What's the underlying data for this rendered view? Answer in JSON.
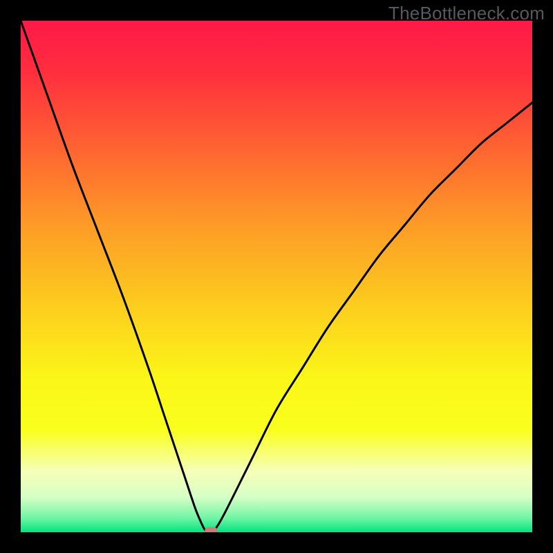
{
  "watermark": "TheBottleneck.com",
  "chart_data": {
    "type": "line",
    "title": "",
    "xlabel": "",
    "ylabel": "",
    "xlim": [
      0,
      100
    ],
    "ylim": [
      0,
      100
    ],
    "grid": false,
    "legend": false,
    "series": [
      {
        "name": "curve",
        "x": [
          0,
          5,
          10,
          15,
          20,
          25,
          28,
          30,
          32,
          34,
          35,
          36,
          37,
          38,
          40,
          45,
          50,
          55,
          60,
          65,
          70,
          75,
          80,
          85,
          90,
          95,
          100
        ],
        "y": [
          100,
          86,
          72,
          59,
          46,
          32,
          23,
          17,
          11,
          5,
          2.5,
          0.5,
          0,
          0.6,
          4,
          14,
          24,
          32,
          40,
          47,
          54,
          60,
          66,
          71,
          76,
          80,
          84
        ]
      }
    ],
    "marker": {
      "x": 37.2,
      "y": 0.3,
      "color": "#cf7a74"
    },
    "background_gradient": {
      "stops": [
        {
          "offset": 0.0,
          "color": "#ff1948"
        },
        {
          "offset": 0.1,
          "color": "#ff2e3e"
        },
        {
          "offset": 0.25,
          "color": "#fe6431"
        },
        {
          "offset": 0.4,
          "color": "#fd9b27"
        },
        {
          "offset": 0.55,
          "color": "#fccb1e"
        },
        {
          "offset": 0.7,
          "color": "#fbf718"
        },
        {
          "offset": 0.8,
          "color": "#faff1e"
        },
        {
          "offset": 0.88,
          "color": "#f6ffb8"
        },
        {
          "offset": 0.93,
          "color": "#d7ffc6"
        },
        {
          "offset": 0.97,
          "color": "#77f6a8"
        },
        {
          "offset": 1.0,
          "color": "#00e47f"
        }
      ]
    },
    "curve_color": "#000000",
    "curve_width": 3
  }
}
